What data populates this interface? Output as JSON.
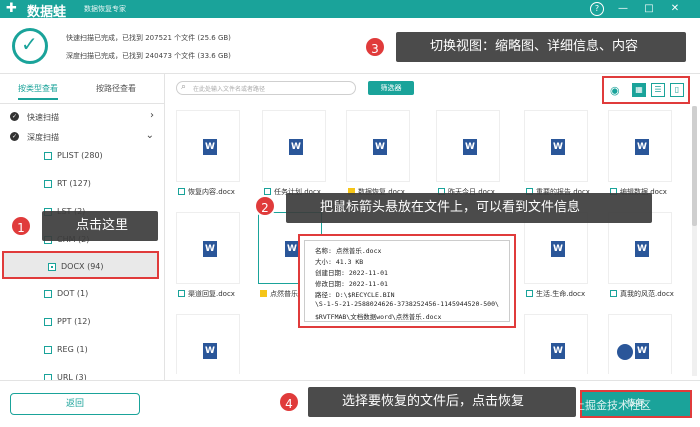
{
  "window": {
    "app_name": "数据蛙",
    "subtitle": "数据恢复专家",
    "controls": [
      "?",
      "—",
      "□",
      "✕"
    ]
  },
  "status": {
    "fast_scan": "快速扫描已完成，已找到 207521 个文件 (25.6 GB)",
    "deep_scan": "深度扫描已完成，已找到 240473 个文件 (33.6 GB)"
  },
  "sidebar": {
    "tabs": [
      "按类型查看",
      "按路径查看"
    ],
    "tree": [
      {
        "label": "快速扫描",
        "arrow": "›"
      },
      {
        "label": "深度扫描",
        "arrow": "⌄"
      }
    ],
    "types": [
      "PLIST (280)",
      "RT (127)",
      "LST (2)",
      "CHM (2)",
      "DOCX (94)",
      "DOT (1)",
      "PPT (12)",
      "REG (1)",
      "URL (3)"
    ]
  },
  "toolbar": {
    "search_placeholder": "在此处输入文件名或者路径",
    "filter_label": "筛选器",
    "view_icons": [
      "grid-icon",
      "list-icon",
      "content-icon"
    ]
  },
  "files": {
    "row1": [
      "恢复内容.docx",
      "任务计划.docx",
      "数据恢复.docx",
      "昨天今日.docx",
      "重要的报告.docx",
      "编辑数据.docx"
    ],
    "row2": [
      "渠道回复.docx",
      "点然普乐.docx",
      "",
      "",
      "生活.生命.docx",
      "真我的风范.docx"
    ]
  },
  "tooltip": {
    "name": "名称: 点然普乐.docx",
    "size": "大小:  41.3 KB",
    "created": "创建日期:  2022-11-01",
    "modified": "修改日期:  2022-11-01",
    "path1": "路径:  D:\\$RECYCLE.BIN",
    "path2": "\\S-1-5-21-2588024626-3738252456-1145944520-500\\",
    "path3": "$RVTFMAB\\文档数据word\\点然普乐.docx"
  },
  "footer": {
    "back_label": "返回",
    "recover_label": "恢复",
    "watermark": "@稀土掘金技术社区"
  },
  "callouts": [
    {
      "num": "1",
      "text": "点击这里"
    },
    {
      "num": "2",
      "text": "把鼠标箭头悬放在文件上，可以看到文件信息"
    },
    {
      "num": "3",
      "text": "切换视图：缩略图、详细信息、内容"
    },
    {
      "num": "4",
      "text": "选择要恢复的文件后，点击恢复"
    }
  ],
  "colors": {
    "accent": "#1aa39a",
    "callout_bg": "#3c3c3c",
    "highlight": "#e03b3b",
    "word_blue": "#2a5699"
  }
}
